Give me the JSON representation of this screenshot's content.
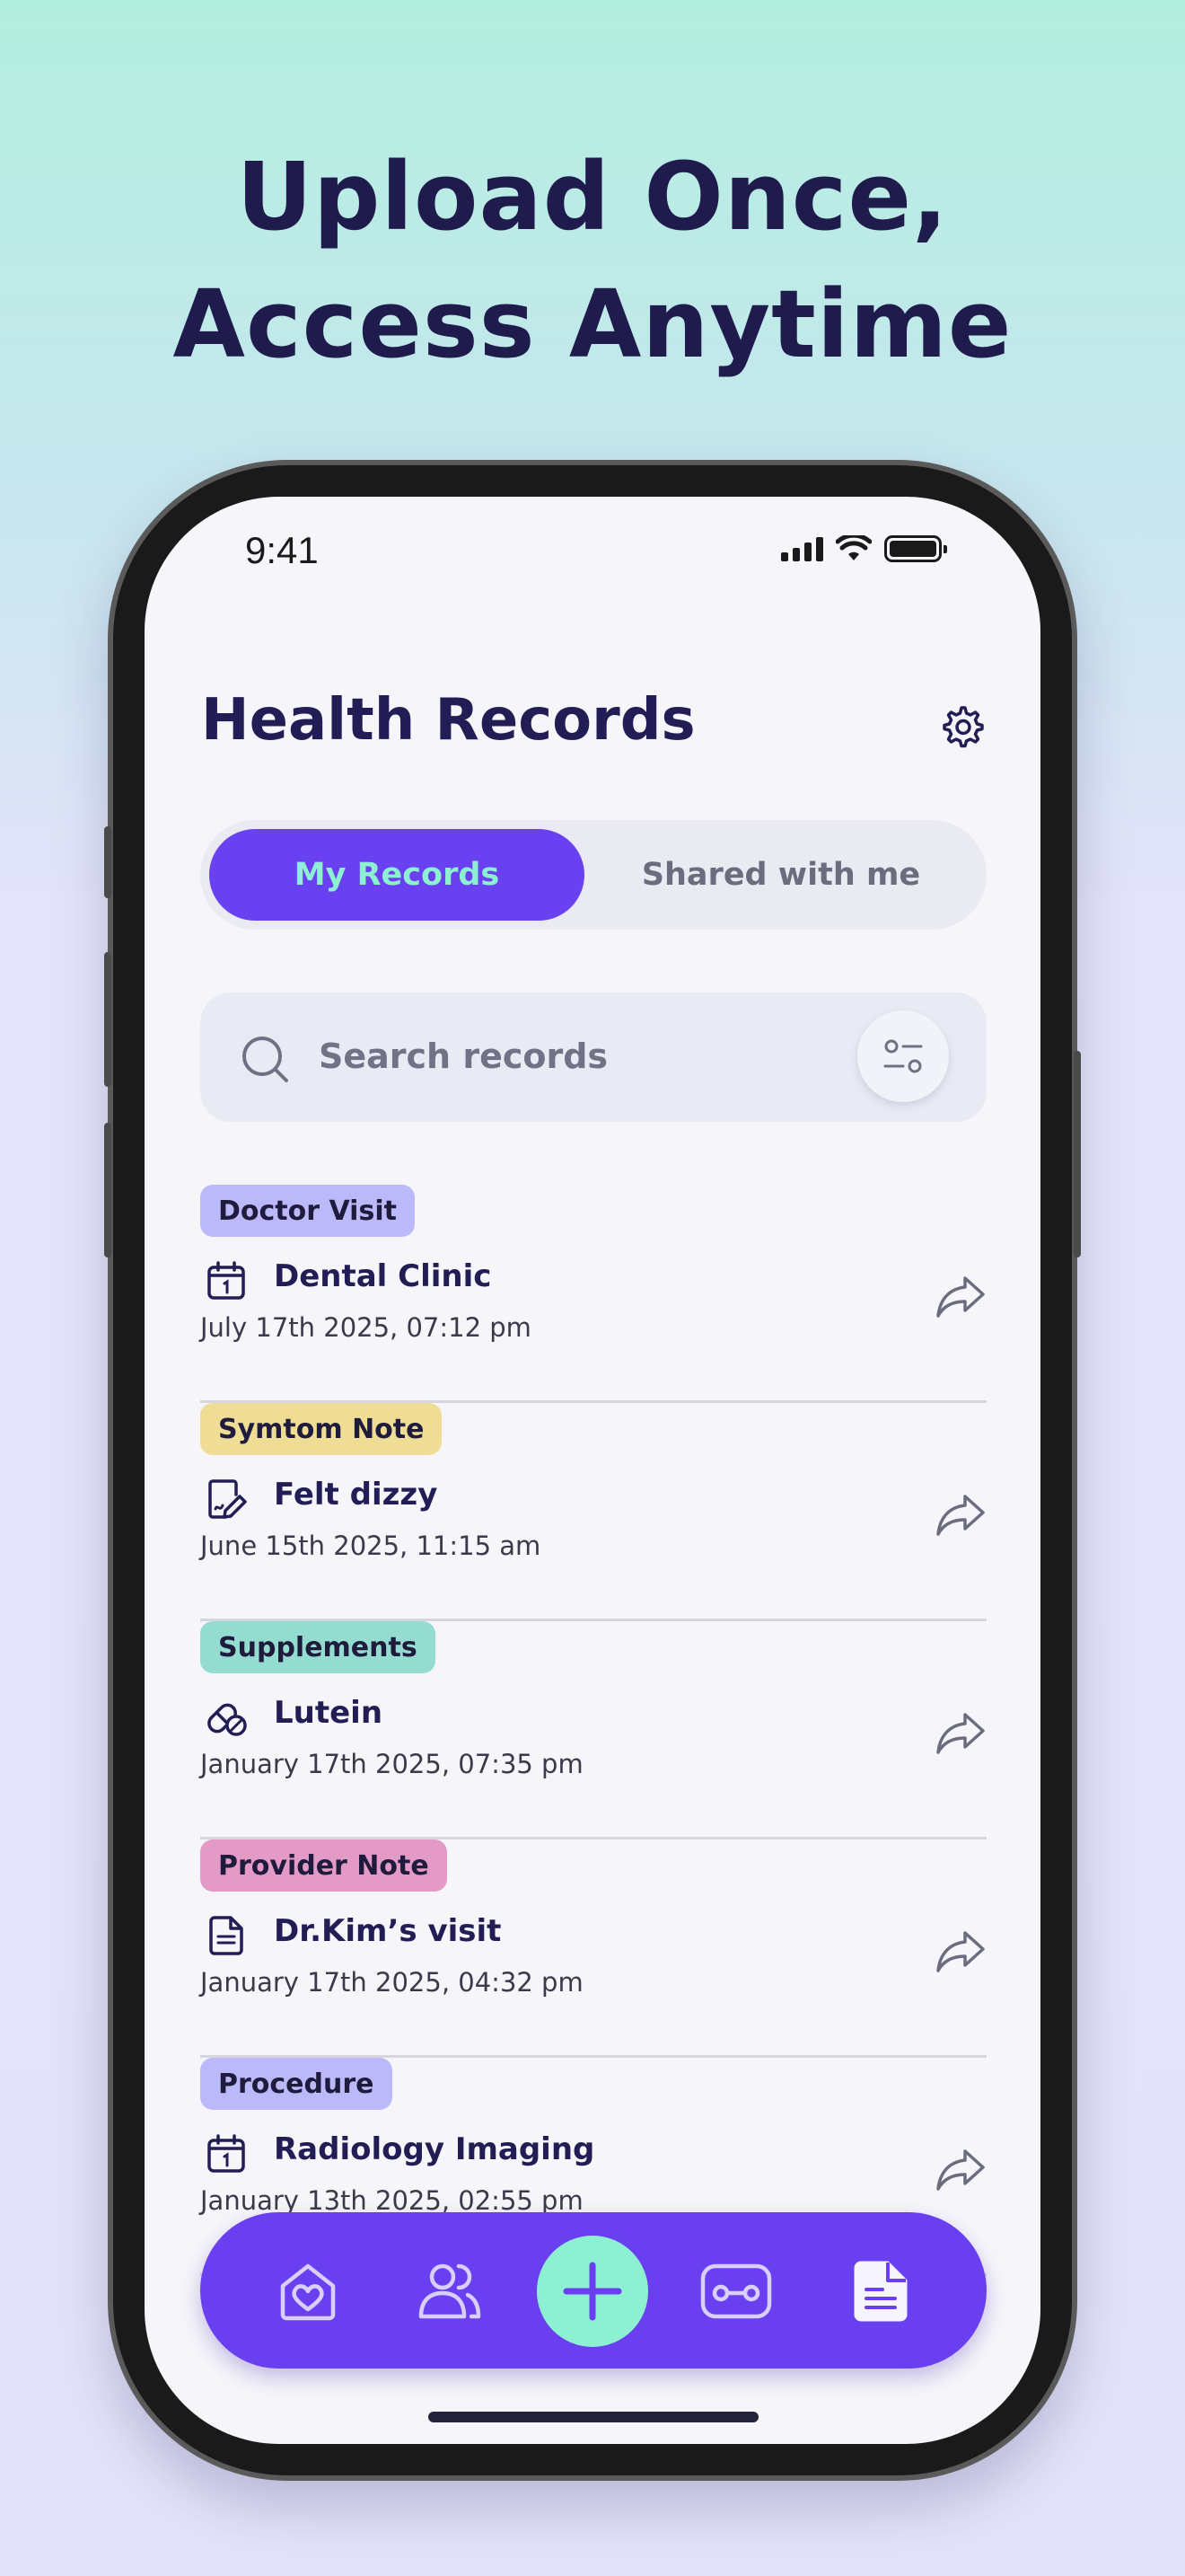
{
  "headline": {
    "line1": "Upload Once,",
    "line2": "Access Anytime"
  },
  "status_bar": {
    "time": "9:41"
  },
  "header": {
    "title": "Health Records"
  },
  "tabs": {
    "active": "My Records",
    "inactive": "Shared with me"
  },
  "search": {
    "placeholder": "Search records"
  },
  "records": [
    {
      "tag": "Doctor Visit",
      "tag_color": "#bcb9fb",
      "icon": "calendar-icon",
      "title": "Dental Clinic",
      "date": "July 17th 2025, 07:12 pm"
    },
    {
      "tag": "Symtom Note",
      "tag_color": "#efdc95",
      "icon": "note-pen-icon",
      "title": "Felt dizzy",
      "date": "June 15th 2025, 11:15 am"
    },
    {
      "tag": "Supplements",
      "tag_color": "#95dcd0",
      "icon": "pill-icon",
      "title": "Lutein",
      "date": "January 17th 2025, 07:35 pm"
    },
    {
      "tag": "Provider Note",
      "tag_color": "#e49ac7",
      "icon": "document-icon",
      "title": "Dr.Kim’s visit",
      "date": "January 17th 2025, 04:32 pm"
    },
    {
      "tag": "Procedure",
      "tag_color": "#bcb9fb",
      "icon": "calendar-icon",
      "title": "Radiology Imaging",
      "date": "January 13th 2025, 02:55 pm"
    }
  ],
  "bottom_nav": {
    "items": [
      "home-heart-icon",
      "people-icon",
      "add-icon",
      "device-icon",
      "records-icon"
    ],
    "accent": "#6a3ff0",
    "add_color": "#8ef0d2"
  },
  "colors": {
    "primary": "#6941f0",
    "accent": "#8ef0d2",
    "text_dark": "#231d55"
  }
}
